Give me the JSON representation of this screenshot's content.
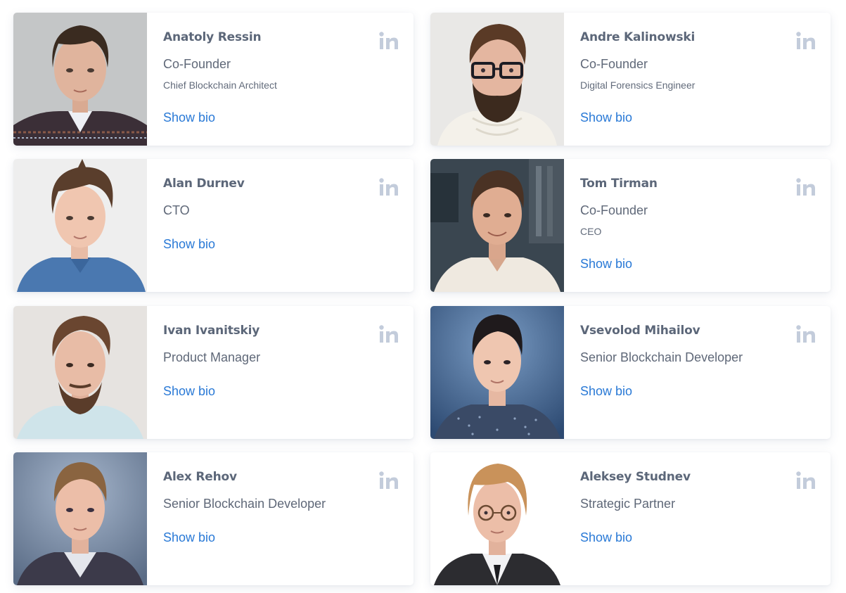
{
  "team": {
    "show_bio_label": "Show bio",
    "linkedin_icon": "linkedin-icon",
    "colors": {
      "name": "#5c6779",
      "role": "#5f6878",
      "link": "#2979d6",
      "linkedin_icon": "#c3ccdb"
    },
    "members": [
      {
        "name": "Anatoly Ressin",
        "role": "Co-Founder",
        "subrole": "Chief Blockchain Architect"
      },
      {
        "name": "Andre Kalinowski",
        "role": "Co-Founder",
        "subrole": "Digital Forensics Engineer"
      },
      {
        "name": "Alan Durnev",
        "role": "CTO",
        "subrole": ""
      },
      {
        "name": "Tom Tirman",
        "role": "Co-Founder",
        "subrole": "CEO"
      },
      {
        "name": "Ivan Ivanitskiy",
        "role": "Product Manager",
        "subrole": ""
      },
      {
        "name": "Vsevolod Mihailov",
        "role": "Senior Blockchain Developer",
        "subrole": ""
      },
      {
        "name": "Alex Rehov",
        "role": "Senior Blockchain Developer",
        "subrole": ""
      },
      {
        "name": "Aleksey Studnev",
        "role": "Strategic Partner",
        "subrole": ""
      }
    ]
  }
}
